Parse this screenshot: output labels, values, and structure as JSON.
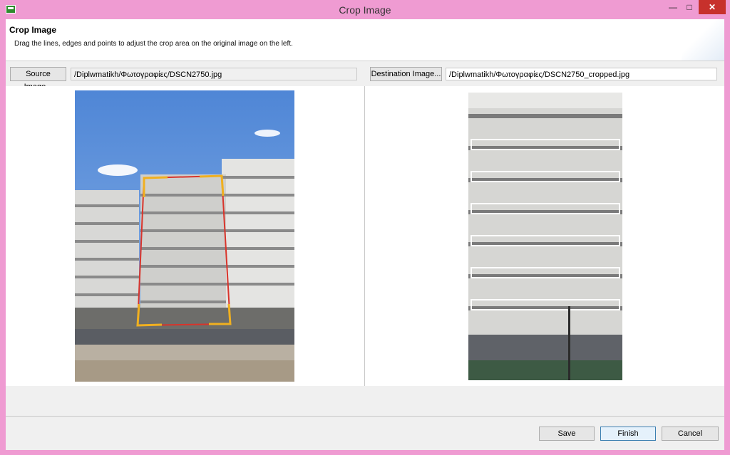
{
  "window": {
    "title": "Crop Image"
  },
  "header": {
    "title": "Crop Image",
    "description": "Drag the lines, edges and points to adjust the crop area on the original image on the left."
  },
  "source": {
    "button_label": "Source Image...",
    "path": "/Diplwmatikh/Φωτογραφίες/DSCN2750.jpg"
  },
  "destination": {
    "button_label": "Destination Image...",
    "path": "/Diplwmatikh/Φωτογραφίες/DSCN2750_cropped.jpg"
  },
  "buttons": {
    "save": "Save",
    "finish": "Finish",
    "cancel": "Cancel"
  },
  "colors": {
    "crop_line": "#d9342b",
    "crop_corner": "#f0b020",
    "titlebar": "#ef9bd2"
  }
}
